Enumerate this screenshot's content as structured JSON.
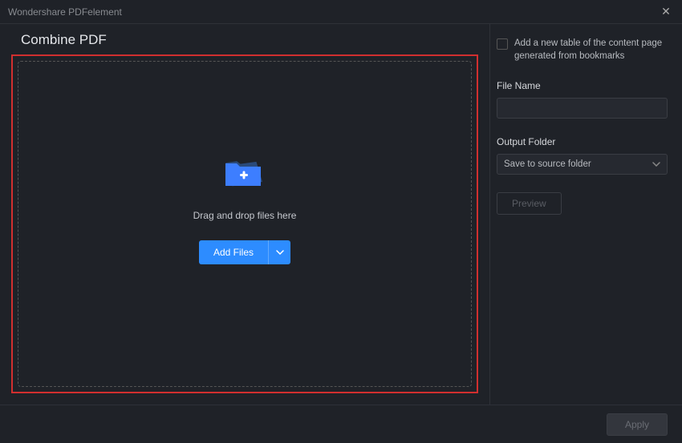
{
  "window": {
    "title": "Wondershare PDFelement"
  },
  "page": {
    "title": "Combine PDF"
  },
  "dropzone": {
    "text": "Drag and drop files here",
    "add_button": "Add Files"
  },
  "sidebar": {
    "checkbox_label": "Add a new table of the content page generated from bookmarks",
    "file_name_label": "File Name",
    "file_name_value": "",
    "output_folder_label": "Output Folder",
    "output_folder_value": "Save to source folder",
    "preview_button": "Preview"
  },
  "footer": {
    "apply_button": "Apply"
  }
}
